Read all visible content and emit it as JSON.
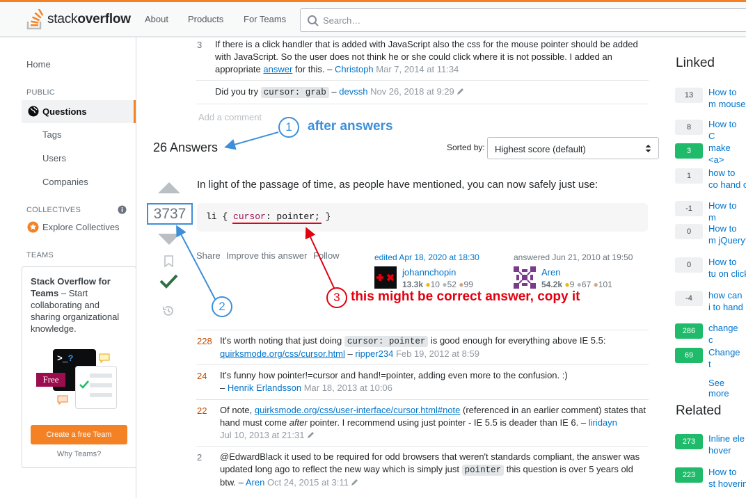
{
  "topbar": {
    "logo_light": "stack",
    "logo_bold": "overflow",
    "nav": [
      "About",
      "Products",
      "For Teams"
    ],
    "search_placeholder": "Search…"
  },
  "leftnav": {
    "home": "Home",
    "public_label": "PUBLIC",
    "questions": "Questions",
    "tags": "Tags",
    "users": "Users",
    "companies": "Companies",
    "collectives_label": "COLLECTIVES",
    "explore_collectives": "Explore Collectives",
    "teams_label": "TEAMS",
    "teams_box": {
      "title": "Stack Overflow for Teams",
      "text": " – Start collaborating and sharing organizational knowledge.",
      "free_badge": "Free",
      "create_button": "Create a free Team",
      "why_link": "Why Teams?"
    }
  },
  "question_comments": [
    {
      "score": "3",
      "text": "If there is a click handler that is added with JavaScript also the css for the mouse pointer should be added with JavaScript. So the user does not think he or she could click where it is not possible. I added an appropriate ",
      "link": "answer",
      "after": " for this. –",
      "user": "Christoph",
      "date": "Mar 7, 2014 at 11:34"
    },
    {
      "score": "",
      "pre": "Did you try ",
      "code": "cursor: grab",
      "after": " –",
      "user": "devssh",
      "date": "Nov 26, 2018 at 9:29"
    }
  ],
  "add_comment": "Add a comment",
  "answers_header": {
    "count": "26 Answers",
    "sorted_by": "Sorted by:",
    "sort_value": "Highest score (default)"
  },
  "answer": {
    "votes": "3737",
    "body": "In light of the passage of time, as people have mentioned, you can now safely just use:",
    "code_pre": "li { ",
    "code_prop": "cursor",
    "code_mid": ": pointer;",
    "code_post": " }",
    "actions": [
      "Share",
      "Improve this answer",
      "Follow"
    ],
    "edited": "edited Apr 18, 2020 at 18:30",
    "editor": {
      "name": "johannchopin",
      "rep": "13.3k",
      "gold": "10",
      "silver": "52",
      "bronze": "99"
    },
    "answered": "answered Jun 21, 2010 at 19:50",
    "author": {
      "name": "Aren",
      "rep": "54.2k",
      "gold": "9",
      "silver": "67",
      "bronze": "101"
    }
  },
  "answer_comments": [
    {
      "score": "228",
      "pre": "It's worth noting that just doing ",
      "code": "cursor: pointer",
      "after": " is good enough for everything above IE 5.5:",
      "link": "quirksmode.org/css/cursor.html",
      "user": "ripper234",
      "date": "Feb 19, 2012 at 8:59"
    },
    {
      "score": "24",
      "text": "It's funny how pointer!=cursor and hand!=pointer, adding even more to the confusion. :)",
      "user": "Henrik Erlandsson",
      "date": "Mar 18, 2013 at 10:06"
    },
    {
      "score": "22",
      "pre": "Of note, ",
      "link": "quirksmode.org/css/user-interface/cursor.html#note",
      "after": " (referenced in an earlier comment) states that hand must come ",
      "em": "after",
      "after2": " pointer. I recommend using just pointer - IE 5.5 is deader than IE 6. –",
      "user": "liridayn",
      "date": "Jul 10, 2013 at 21:31"
    },
    {
      "score": "2",
      "pre": "@EdwardBlack it used to be required for odd browsers that weren't standards compliant, the answer was updated long ago to reflect the new way which is simply just ",
      "code": "pointer",
      "after": " this question is over 5 years old btw. –",
      "user": "Aren",
      "date": "Oct 24, 2015 at 3:11"
    }
  ],
  "annotations": {
    "one_num": "1",
    "one_text": "after answers",
    "two_num": "2",
    "three_num": "3",
    "three_text": "this might be correct answer, copy it"
  },
  "linked": {
    "title": "Linked",
    "items": [
      {
        "score": "13",
        "text": "How to m mouse w",
        "green": false
      },
      {
        "score": "8",
        "text": "How to C",
        "green": false
      },
      {
        "score": "3",
        "text": "make <a>",
        "green": true
      },
      {
        "score": "1",
        "text": "how to co hand onm",
        "green": false
      },
      {
        "score": "-1",
        "text": "How to m",
        "green": false
      },
      {
        "score": "0",
        "text": "How to m jQuery?",
        "green": false
      },
      {
        "score": "0",
        "text": "How to tu on clickab",
        "green": false
      },
      {
        "score": "-4",
        "text": "how can i to hand in",
        "green": false
      },
      {
        "score": "286",
        "text": "change c",
        "green": true
      },
      {
        "score": "69",
        "text": "Change t",
        "green": true
      }
    ],
    "see_more": "See more"
  },
  "related": {
    "title": "Related",
    "items": [
      {
        "score": "273",
        "text": "Inline ele hover",
        "green": true
      },
      {
        "score": "223",
        "text": "How to st hovering",
        "green": true
      }
    ]
  },
  "colors": {
    "accent": "#f48225",
    "link": "#0074cc",
    "annot_blue": "#3d8fd9",
    "annot_red": "#e3000f",
    "accepted": "#2f6f44"
  }
}
